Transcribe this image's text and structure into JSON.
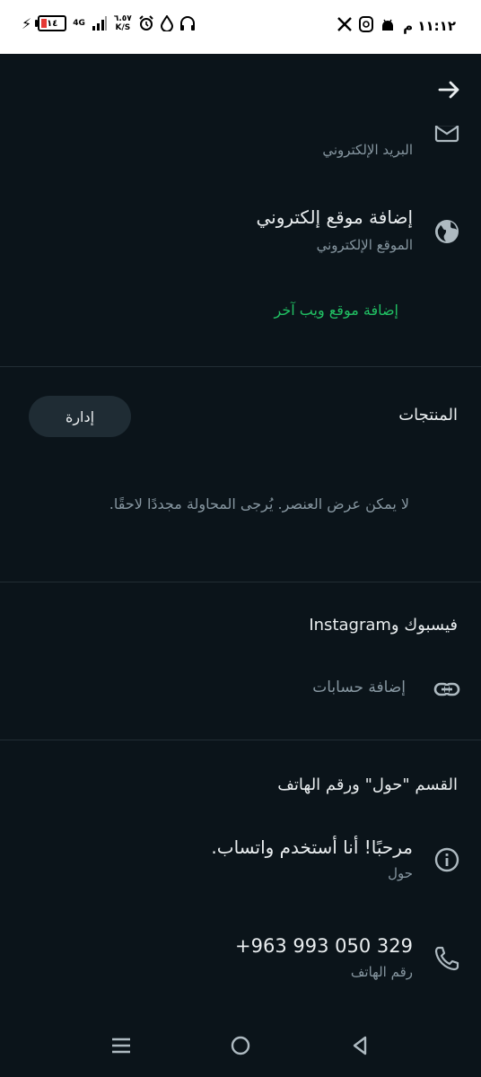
{
  "status_bar": {
    "time": "١١:١٢ م",
    "battery": "١٤",
    "network": "4G",
    "speed_value": "٦.٥٧",
    "speed_unit": "K/S",
    "app_icons": [
      "android-icon",
      "threads-icon",
      "x-icon"
    ]
  },
  "contact": {
    "email_subtitle": "البريد الإلكتروني",
    "website_title": "إضافة موقع إلكتروني",
    "website_subtitle": "الموقع الإلكتروني",
    "add_another_website": "إضافة موقع ويب آخر"
  },
  "products": {
    "title": "المنتجات",
    "manage_label": "إدارة",
    "error_text": "لا يمكن عرض العنصر. يُرجى المحاولة مجددًا لاحقًا."
  },
  "social": {
    "title": "فيسبوك وInstagram",
    "add_accounts": "إضافة حسابات"
  },
  "about_phone": {
    "title": "القسم \"حول\" ورقم الهاتف",
    "about_value": "مرحبًا! أنا أستخدم واتساب.",
    "about_label": "حول",
    "phone_value": "+963 993 050 329",
    "phone_label": "رقم الهاتف"
  },
  "colors": {
    "background": "#0b141a",
    "accent": "#21c063",
    "secondary_text": "#8696a0",
    "button_bg": "#1f2c34"
  }
}
